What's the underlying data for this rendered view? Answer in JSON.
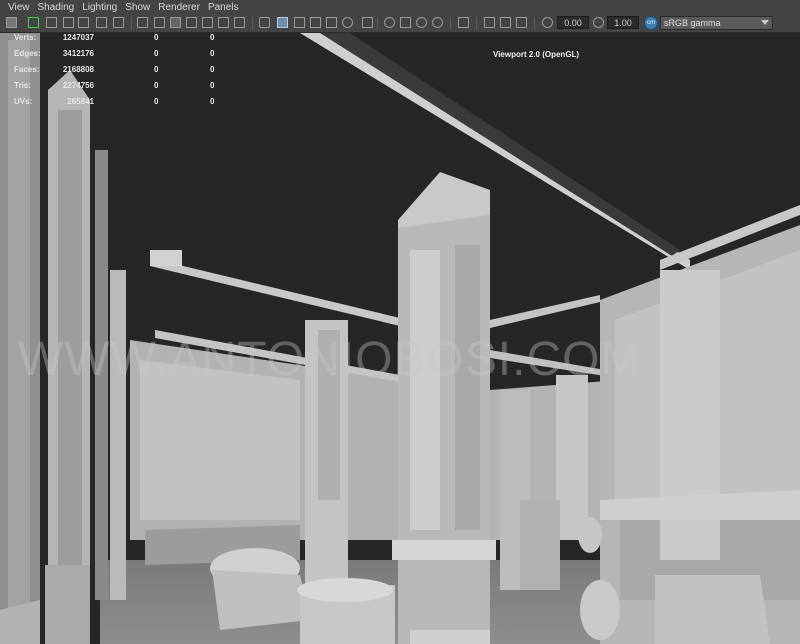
{
  "menu": [
    "View",
    "Shading",
    "Lighting",
    "Show",
    "Renderer",
    "Panels"
  ],
  "toolbar": {
    "exposure": "0.00",
    "gamma": "1.00",
    "color_space": "sRGB gamma",
    "color_space_badge": "cm"
  },
  "hud": {
    "rows": [
      {
        "label": "Verts:",
        "v1": "1247037",
        "v2": "0",
        "v3": "0"
      },
      {
        "label": "Edges:",
        "v1": "3412176",
        "v2": "0",
        "v3": "0"
      },
      {
        "label": "Faces:",
        "v1": "2168808",
        "v2": "0",
        "v3": "0"
      },
      {
        "label": "Tris:",
        "v1": "2274756",
        "v2": "0",
        "v3": "0"
      },
      {
        "label": "UVs:",
        "v1": "265841",
        "v2": "0",
        "v3": "0"
      }
    ]
  },
  "renderer_label": "Viewport 2.0 (OpenGL)",
  "watermark": "WWW.ANTONIOBOSI.COM",
  "colors": {
    "background": "#262626",
    "toolbar": "#444444",
    "geometry": "#a8a8a8",
    "accent": "#3b7fb5"
  }
}
